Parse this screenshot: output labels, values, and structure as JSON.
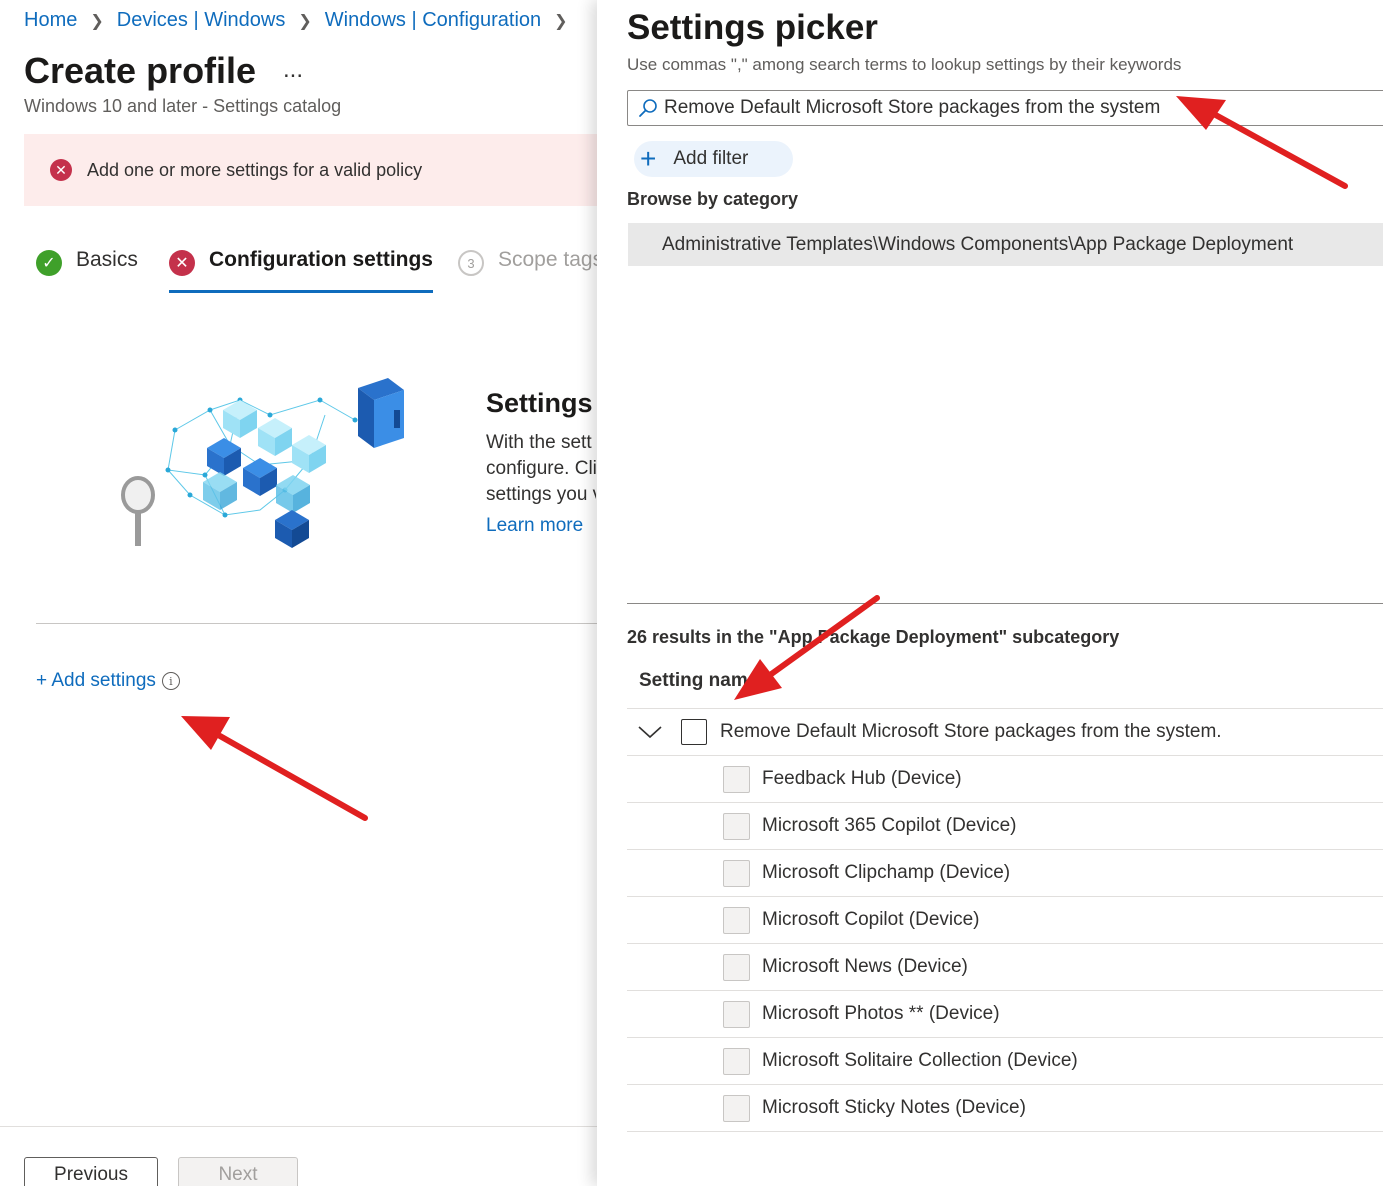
{
  "breadcrumb": {
    "items": [
      "Home",
      "Devices | Windows",
      "Windows | Configuration"
    ]
  },
  "header": {
    "title": "Create profile",
    "more": "...",
    "subtitle": "Windows 10 and later - Settings catalog"
  },
  "error_banner": {
    "text": "Add one or more settings for a valid policy"
  },
  "wizard_tabs": [
    {
      "label": "Basics",
      "state": "complete"
    },
    {
      "label": "Configuration settings",
      "state": "error",
      "selected": true
    },
    {
      "label": "Scope tags",
      "step": "3",
      "state": "pending"
    }
  ],
  "settings_intro": {
    "heading": "Settings",
    "desc_lines": [
      "With the sett",
      "configure. Cli",
      "settings you v"
    ],
    "learn_more": "Learn more"
  },
  "add_settings": {
    "label": "+ Add settings",
    "info": "i"
  },
  "footer": {
    "previous": "Previous",
    "next": "Next"
  },
  "picker": {
    "title": "Settings picker",
    "subtitle": "Use commas \",\" among search terms to lookup settings by their keywords",
    "search_value": "Remove Default Microsoft Store packages from the system",
    "add_filter": "Add filter",
    "browse_label": "Browse by category",
    "category": "Administrative Templates\\Windows Components\\App Package Deployment",
    "results_count": "26 results in the \"App Package Deployment\" subcategory",
    "column_header": "Setting name",
    "parent_setting": "Remove Default Microsoft Store packages from the system.",
    "child_settings": [
      "Feedback Hub (Device)",
      "Microsoft 365 Copilot (Device)",
      "Microsoft Clipchamp (Device)",
      "Microsoft Copilot (Device)",
      "Microsoft News (Device)",
      "Microsoft Photos ** (Device)",
      "Microsoft Solitaire Collection (Device)",
      "Microsoft Sticky Notes (Device)"
    ]
  },
  "colors": {
    "link": "#0f6cbd",
    "error": "#c4314b",
    "success": "#3fa02a",
    "error_bg": "#fdeceb",
    "annotation_arrow": "#e02020"
  }
}
